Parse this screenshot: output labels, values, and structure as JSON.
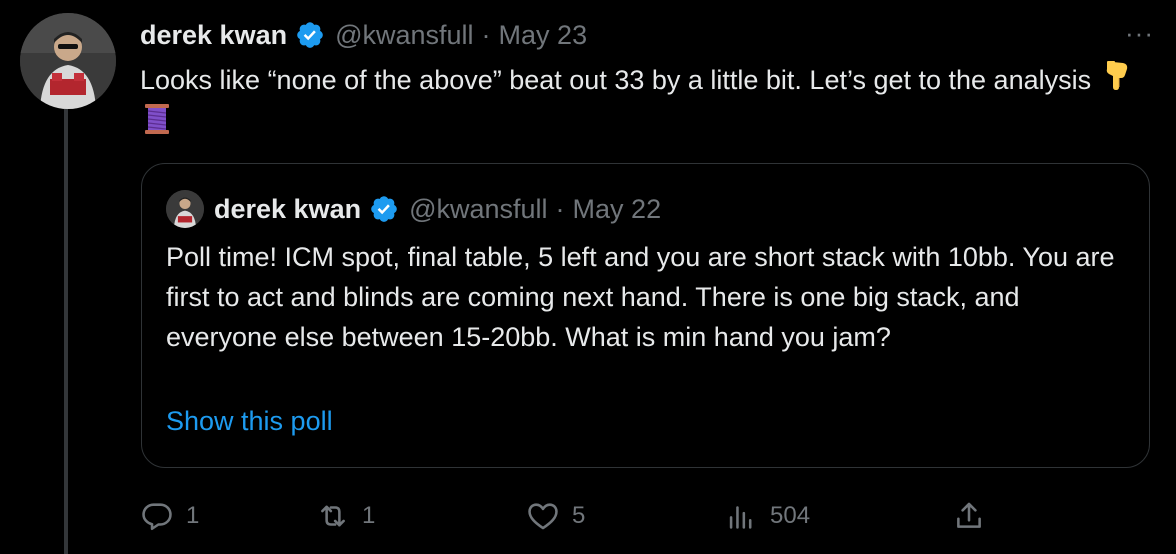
{
  "tweet": {
    "author_name": "derek kwan",
    "handle": "@kwansfull",
    "separator": "·",
    "date": "May 23",
    "text": "Looks like “none of the above” beat out 33 by a little bit. Let’s get to the analysis",
    "emojis": [
      "backhand-index-pointing-down-icon",
      "thread-spool-icon"
    ],
    "more_menu": "···"
  },
  "quoted_tweet": {
    "author_name": "derek kwan",
    "handle": "@kwansfull",
    "separator": "·",
    "date": "May 22",
    "text": "Poll time! ICM spot, final table, 5 left and you are short stack with 10bb. You are first to act and blinds are coming next hand. There is one big stack, and everyone else between 15-20bb. What is min hand you jam?",
    "link": "Show this poll"
  },
  "actions": {
    "replies": "1",
    "retweets": "1",
    "likes": "5",
    "views": "504"
  },
  "colors": {
    "background": "#000000",
    "text_primary": "#e7e9ea",
    "text_secondary": "#71767b",
    "link": "#1d9bf0",
    "verified": "#1d9bf0",
    "border": "#2f3336"
  }
}
